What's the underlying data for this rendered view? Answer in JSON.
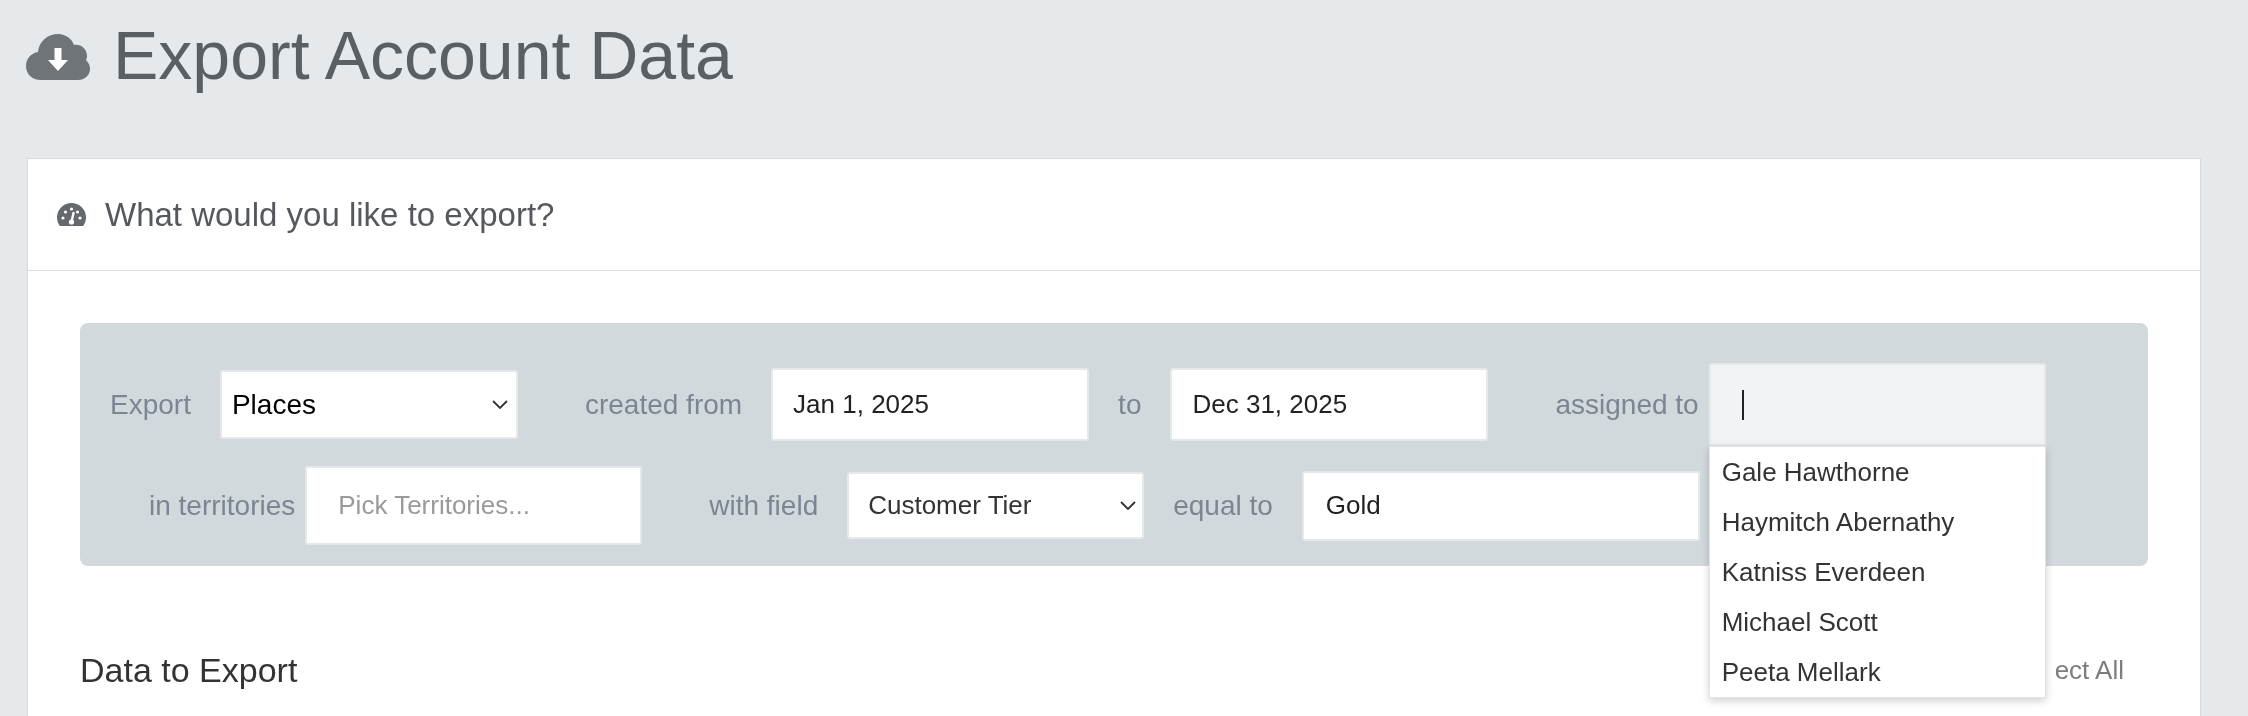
{
  "page": {
    "title": "Export Account Data"
  },
  "card": {
    "title": "What would you like to export?"
  },
  "filter_rows": [
    {
      "fields": [
        {
          "label": "Export",
          "kind": "select",
          "value": "Places"
        },
        {
          "label": "created from",
          "kind": "date_range",
          "start": "Jan 1, 2025",
          "separator": "to",
          "end": "Dec 31, 2025"
        },
        {
          "label": "assigned to",
          "kind": "typeahead",
          "focused": true,
          "suggestions": [
            {
              "label": "Gale Hawthorne",
              "selected": false
            },
            {
              "label": "Haymitch Abernathy",
              "selected": false
            },
            {
              "label": "Katniss Everdeen",
              "selected": false
            },
            {
              "label": "Michael Scott",
              "selected": false
            },
            {
              "label": "Peeta Mellark",
              "selected": false
            }
          ]
        }
      ]
    },
    {
      "fields": [
        {
          "label": "in territories",
          "kind": "picker",
          "placeholder": "Pick Territories..."
        },
        {
          "label": "with field",
          "kind": "field_condition",
          "field": "Customer Tier",
          "operator": "equal to",
          "value": "Gold"
        }
      ]
    }
  ],
  "data_section": {
    "title": "Data to Export",
    "action": "ect All"
  }
}
